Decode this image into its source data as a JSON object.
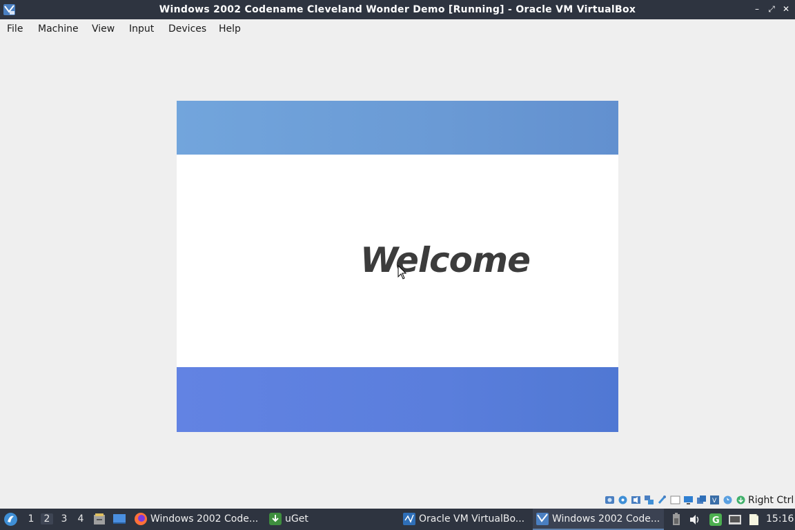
{
  "window": {
    "title": "Windows 2002 Codename Cleveland Wonder Demo [Running] - Oracle VM VirtualBox",
    "app_icon": "virtualbox-xp-icon",
    "controls": {
      "minimize": "–",
      "maximize": "⤢",
      "close": "✕"
    }
  },
  "menubar": {
    "items": [
      "File",
      "Machine",
      "View",
      "Input",
      "Devices",
      "Help"
    ]
  },
  "vm_screen": {
    "welcome_text": "Welcome",
    "top_band_color": "#6a9ad5",
    "bottom_band_color": "#5a7edc",
    "background_color": "#ffffff"
  },
  "statusbar": {
    "icons": [
      "hard-disk-icon",
      "optical-drive-icon",
      "audio-icon",
      "network-icon",
      "usb-icon",
      "shared-folders-icon",
      "display-icon",
      "recording-icon",
      "cpu-icon",
      "mouse-integration-icon",
      "keyboard-icon"
    ],
    "host_key": "Right Ctrl"
  },
  "taskbar": {
    "workspaces": [
      "1",
      "2",
      "3",
      "4"
    ],
    "active_workspace": "2",
    "tasks": [
      {
        "label": "Windows 2002 Code...",
        "icon": "firefox-icon"
      },
      {
        "label": "uGet",
        "icon": "uget-icon"
      },
      {
        "label": "Oracle VM VirtualBo...",
        "icon": "virtualbox-manager-icon"
      },
      {
        "label": "Windows 2002 Code...",
        "icon": "virtualbox-vm-icon"
      }
    ],
    "clock": "15:16",
    "accent_color": "#2e3440"
  }
}
